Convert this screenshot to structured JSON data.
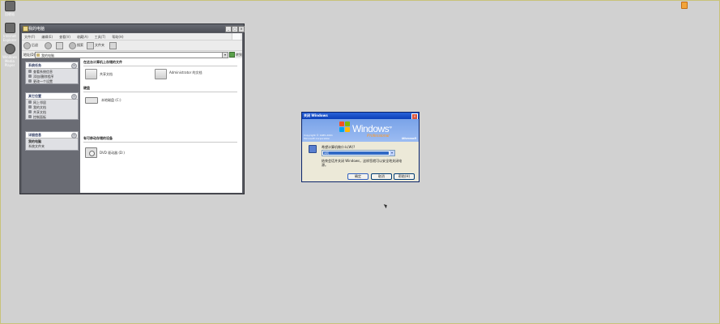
{
  "desktop": {
    "icons": [
      {
        "label": "回收站",
        "icon": "recycle-bin-icon"
      },
      {
        "label": "Internet Explorer",
        "icon": "internet-explorer-icon"
      },
      {
        "label": "Windows Media Player",
        "icon": "media-player-icon"
      }
    ]
  },
  "explorer": {
    "title": "我的电脑",
    "menu": [
      "文件(F)",
      "编辑(E)",
      "查看(V)",
      "收藏(A)",
      "工具(T)",
      "帮助(H)"
    ],
    "toolbar": {
      "back_label": "后退",
      "search_label": "搜索",
      "folders_label": "文件夹"
    },
    "address": {
      "label": "地址(D)",
      "value": "我的电脑",
      "go_label": "转到"
    },
    "taskpane": {
      "system_tasks": {
        "title": "系统任务",
        "items": [
          "查看系统信息",
          "添加/删除程序",
          "更改一个设置"
        ]
      },
      "other_places": {
        "title": "其它位置",
        "items": [
          "网上邻居",
          "我的文档",
          "共享文档",
          "控制面板"
        ]
      },
      "details": {
        "title": "详细信息",
        "name": "我的电脑",
        "kind": "系统文件夹"
      }
    },
    "content": {
      "section_files": "在这台计算机上存储的文件",
      "shared_docs": "共享文档",
      "admin_docs": "Administrator 的文档",
      "section_drives": "硬盘",
      "local_disk": "本地磁盘 (C:)",
      "section_removable": "有可移动存储的设备",
      "cd_drive": "DVD 驱动器 (D:)"
    }
  },
  "shutdown_dialog": {
    "title": "关闭 Windows",
    "copyright": [
      "Copyright © 1985-2001",
      "Microsoft Corporation"
    ],
    "brand": "Windows",
    "brand_sup": "xp",
    "edition": "Professional",
    "microsoft": "Microsoft",
    "prompt": "希望计算机做什么(W)?",
    "selected_option": "关机",
    "description": "结束会话并关闭 Windows，这样您就可以安全地关闭电源。",
    "buttons": {
      "ok": "确定",
      "cancel": "取消",
      "help": "帮助(H)"
    }
  },
  "colors": {
    "desktop": "#d1d1d1",
    "xp_title": "#0b3fb8",
    "dialog_face": "#ece9d8"
  }
}
